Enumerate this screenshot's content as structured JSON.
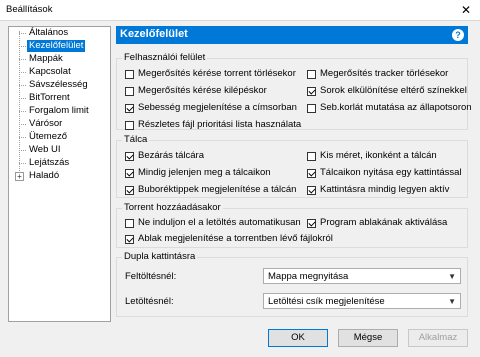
{
  "window": {
    "title": "Beállítások",
    "close_glyph": "✕"
  },
  "tree": {
    "items": [
      {
        "label": "Általános"
      },
      {
        "label": "Kezelőfelület",
        "selected": true
      },
      {
        "label": "Mappák"
      },
      {
        "label": "Kapcsolat"
      },
      {
        "label": "Sávszélesség"
      },
      {
        "label": "BitTorrent"
      },
      {
        "label": "Forgalom limit"
      },
      {
        "label": "Várósor"
      },
      {
        "label": "Ütemező"
      },
      {
        "label": "Web UI"
      },
      {
        "label": "Lejátszás"
      },
      {
        "label": "Haladó",
        "expander": "+"
      }
    ]
  },
  "panel": {
    "title": "Kezelőfelület",
    "help_glyph": "?",
    "groups": {
      "felhasznaloi": {
        "label": "Felhasználói felület",
        "checks": [
          {
            "label": "Megerősítés kérése torrent törlésekor",
            "checked": false
          },
          {
            "label": "Megerősítés tracker törlésekor",
            "checked": false
          },
          {
            "label": "Megerősítés kérése kilépéskor",
            "checked": false
          },
          {
            "label": "Sorok elkülönítése eltérő színekkel",
            "checked": true
          },
          {
            "label": "Sebesség megjelenítése a címsorban",
            "checked": true
          },
          {
            "label": "Seb.korlát mutatása az állapotsoron",
            "checked": false
          },
          {
            "label": "Részletes fájl prioritási lista használata",
            "checked": false
          }
        ]
      },
      "talca": {
        "label": "Tálca",
        "checks": [
          {
            "label": "Bezárás tálcára",
            "checked": true
          },
          {
            "label": "Kis méret, ikonként a tálcán",
            "checked": false
          },
          {
            "label": "Mindig jelenjen meg a tálcaikon",
            "checked": true
          },
          {
            "label": "Tálcaikon nyitása egy kattintással",
            "checked": true
          },
          {
            "label": "Buboréktippek megjelenítése a tálcán",
            "checked": true
          },
          {
            "label": "Kattintásra mindig legyen aktív",
            "checked": true
          }
        ]
      },
      "torrent": {
        "label": "Torrent hozzáadásakor",
        "checks": [
          {
            "label": "Ne induljon el a letöltés automatikusan",
            "checked": false
          },
          {
            "label": "Program ablakának aktiválása",
            "checked": true
          },
          {
            "label": "Ablak megjelenítése a torrentben lévő fájlokról",
            "checked": true
          }
        ]
      },
      "dupla": {
        "label": "Dupla kattintásra",
        "rows": [
          {
            "label": "Feltöltésnél:",
            "value": "Mappa megnyitása"
          },
          {
            "label": "Letöltésnél:",
            "value": "Letöltési csík megjelenítése"
          }
        ]
      }
    }
  },
  "footer": {
    "ok": "OK",
    "cancel": "Mégse",
    "apply": "Alkalmaz"
  }
}
